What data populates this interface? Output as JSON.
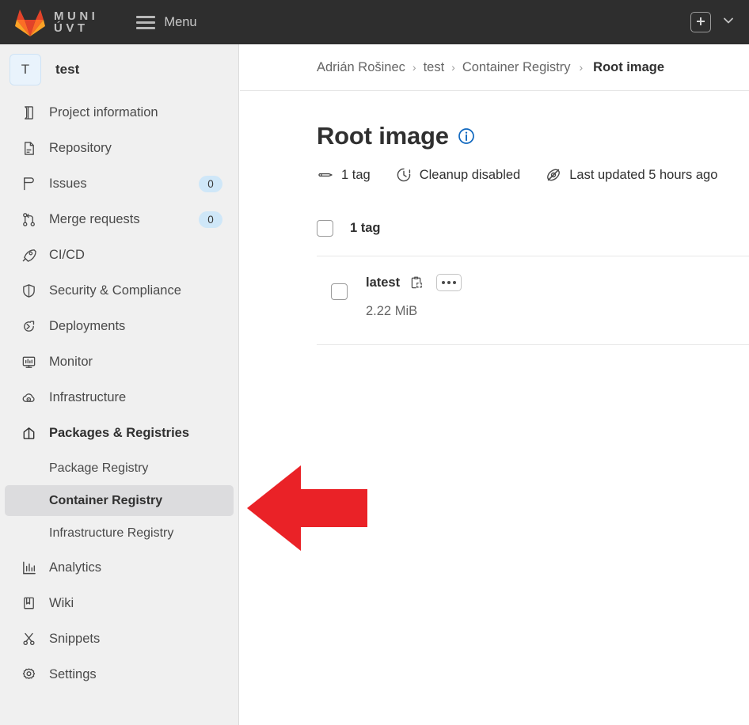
{
  "navbar": {
    "brand_line1": "MUNI",
    "brand_line2": "ÚVT",
    "logo_icon": "gitlab-fox-logo",
    "menu_label": "Menu",
    "menu_icon": "hamburger-icon",
    "new_icon": "plus-icon",
    "chevron_icon": "chevron-down-icon",
    "bg_color": "#2e2e2e"
  },
  "sidebar": {
    "project_initial": "T",
    "project_name": "test",
    "items": [
      {
        "label": "Project information",
        "icon": "book-icon",
        "badge": null
      },
      {
        "label": "Repository",
        "icon": "doc-code-icon",
        "badge": null
      },
      {
        "label": "Issues",
        "icon": "issue-icon",
        "badge": "0"
      },
      {
        "label": "Merge requests",
        "icon": "merge-request-icon",
        "badge": "0"
      },
      {
        "label": "CI/CD",
        "icon": "rocket-icon",
        "badge": null
      },
      {
        "label": "Security & Compliance",
        "icon": "shield-icon",
        "badge": null
      },
      {
        "label": "Deployments",
        "icon": "deployments-icon",
        "badge": null
      },
      {
        "label": "Monitor",
        "icon": "monitor-icon",
        "badge": null
      },
      {
        "label": "Infrastructure",
        "icon": "cloud-gear-icon",
        "badge": null
      },
      {
        "label": "Packages & Registries",
        "icon": "package-icon",
        "badge": null
      }
    ],
    "sub_items": [
      {
        "label": "Package Registry",
        "selected": false
      },
      {
        "label": "Container Registry",
        "selected": true
      },
      {
        "label": "Infrastructure Registry",
        "selected": false
      }
    ],
    "items_after": [
      {
        "label": "Analytics",
        "icon": "chart-icon",
        "badge": null
      },
      {
        "label": "Wiki",
        "icon": "wiki-book-icon",
        "badge": null
      },
      {
        "label": "Snippets",
        "icon": "scissors-icon",
        "badge": null
      },
      {
        "label": "Settings",
        "icon": "gear-icon",
        "badge": null
      }
    ],
    "bg_color": "#f0f0f0",
    "selected_bg_color": "#dcdcde"
  },
  "breadcrumb": {
    "items": [
      {
        "label": "Adrián Rošinec",
        "current": false
      },
      {
        "label": "test",
        "current": false
      },
      {
        "label": "Container Registry",
        "current": false
      },
      {
        "label": "Root image",
        "current": true
      }
    ],
    "separator": "›"
  },
  "main": {
    "page_title": "Root image",
    "info_icon": "info-circle-icon",
    "info_icon_color": "#1068bf",
    "meta": [
      {
        "icon": "tag-icon",
        "label": "1 tag"
      },
      {
        "icon": "clock-cleanup-icon",
        "label": "Cleanup disabled"
      },
      {
        "icon": "eye-slash-icon",
        "label": "Last updated 5 hours ago"
      }
    ],
    "tags_header_label": "1 tag",
    "tags": [
      {
        "name": "latest",
        "size": "2.22 MiB",
        "copy_icon": "copy-clipboard-icon",
        "more_actions_icon": "ellipsis-icon",
        "checked": false
      }
    ]
  },
  "annotation": {
    "type": "arrow",
    "direction": "left",
    "color": "#ea2227",
    "points_at": "Container Registry"
  }
}
